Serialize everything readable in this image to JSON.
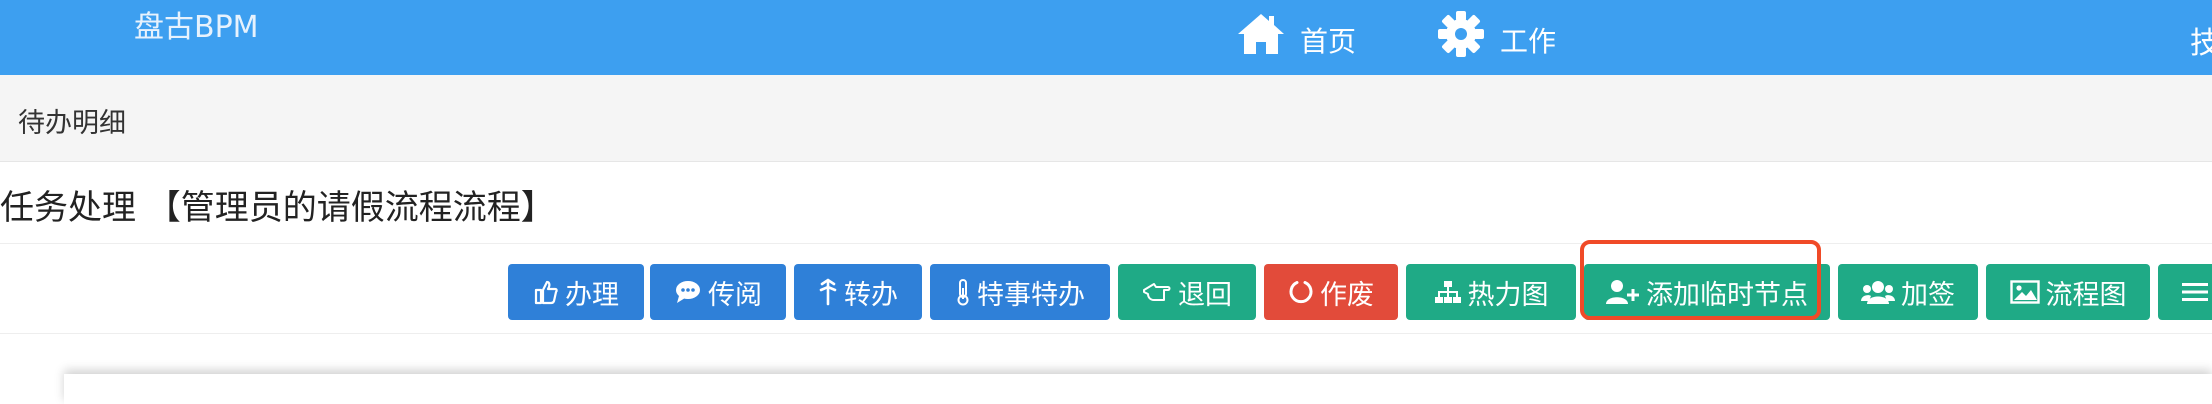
{
  "header": {
    "brand": "盘古BPM",
    "nav": [
      {
        "label": "首页",
        "icon": "home-icon"
      },
      {
        "label": "工作",
        "icon": "gear-icon"
      }
    ],
    "overflow_text": "技"
  },
  "subheader": {
    "title": "待办明细"
  },
  "page": {
    "title": "任务处理 【管理员的请假流程流程】"
  },
  "toolbar": {
    "buttons": [
      {
        "label": "办理",
        "icon": "thumbs-up-icon",
        "color": "#2f80d8"
      },
      {
        "label": "传阅",
        "icon": "comment-icon",
        "color": "#2f80d8"
      },
      {
        "label": "转办",
        "icon": "transfer-icon",
        "color": "#2f80d8"
      },
      {
        "label": "特事特办",
        "icon": "thermometer-icon",
        "color": "#2f80d8"
      },
      {
        "label": "退回",
        "icon": "hand-left-icon",
        "color": "#1faa86"
      },
      {
        "label": "作废",
        "icon": "circle-notch-icon",
        "color": "#e24b3a"
      },
      {
        "label": "热力图",
        "icon": "sitemap-icon",
        "color": "#1faa86"
      },
      {
        "label": "添加临时节点",
        "icon": "user-plus-icon",
        "color": "#1faa86",
        "highlighted": true
      },
      {
        "label": "加签",
        "icon": "users-icon",
        "color": "#1faa86"
      },
      {
        "label": "流程图",
        "icon": "image-icon",
        "color": "#1faa86"
      },
      {
        "label": "",
        "icon": "menu-icon",
        "color": "#1faa86"
      }
    ]
  },
  "annotation": {
    "highlight_color": "#f04a27"
  }
}
